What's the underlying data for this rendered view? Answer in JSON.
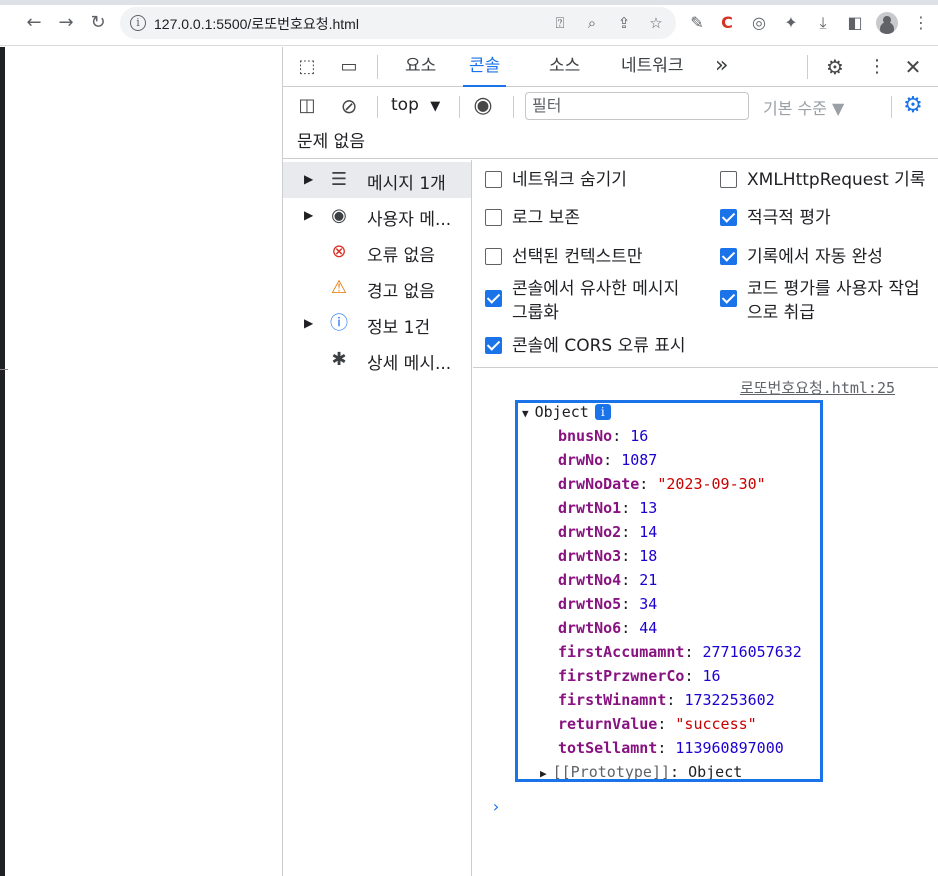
{
  "browser": {
    "url": "127.0.0.1:5500/로또번호요청.html",
    "nav": {
      "back_icon": "arrow-left-icon",
      "forward_icon": "arrow-right-icon",
      "reload_icon": "reload-icon"
    }
  },
  "devtools": {
    "tabs": [
      {
        "label": "요소",
        "active": false
      },
      {
        "label": "콘솔",
        "active": true
      },
      {
        "label": "소스",
        "active": false
      },
      {
        "label": "네트워크",
        "active": false
      }
    ],
    "more_tabs": "»",
    "context": "top",
    "filter_placeholder": "필터",
    "levels": "기본 수준 ▼",
    "issues": "문제 없음"
  },
  "sidebar": {
    "items": [
      {
        "label": "메시지 1개",
        "icon": "list-icon",
        "has_arrow": true
      },
      {
        "label": "사용자 메...",
        "icon": "user-icon",
        "has_arrow": true
      },
      {
        "label": "오류 없음",
        "icon": "error-icon",
        "has_arrow": false
      },
      {
        "label": "경고 없음",
        "icon": "warning-icon",
        "has_arrow": false
      },
      {
        "label": "정보 1건",
        "icon": "info-icon",
        "has_arrow": true
      },
      {
        "label": "상세 메시...",
        "icon": "bug-icon",
        "has_arrow": false
      }
    ]
  },
  "settings": {
    "left": [
      {
        "label": "네트워크 숨기기",
        "checked": false
      },
      {
        "label": "로그 보존",
        "checked": false
      },
      {
        "label": "선택된 컨텍스트만",
        "checked": false
      },
      {
        "label": "콘솔에서 유사한 메시지 그룹화",
        "checked": true
      },
      {
        "label": "콘솔에 CORS 오류 표시",
        "checked": true
      }
    ],
    "right": [
      {
        "label": "XMLHttpRequest 기록",
        "checked": false
      },
      {
        "label": "적극적 평가",
        "checked": true
      },
      {
        "label": "기록에서 자동 완성",
        "checked": true
      },
      {
        "label": "코드 평가를 사용자 작업으로 취급",
        "checked": true
      }
    ]
  },
  "console": {
    "source": "로또번호요청.html:25",
    "object_label": "Object",
    "info_badge": "i",
    "props": [
      {
        "key": "bnusNo",
        "value": "16",
        "kind": "num"
      },
      {
        "key": "drwNo",
        "value": "1087",
        "kind": "num"
      },
      {
        "key": "drwNoDate",
        "value": "\"2023-09-30\"",
        "kind": "str"
      },
      {
        "key": "drwtNo1",
        "value": "13",
        "kind": "num"
      },
      {
        "key": "drwtNo2",
        "value": "14",
        "kind": "num"
      },
      {
        "key": "drwtNo3",
        "value": "18",
        "kind": "num"
      },
      {
        "key": "drwtNo4",
        "value": "21",
        "kind": "num"
      },
      {
        "key": "drwtNo5",
        "value": "34",
        "kind": "num"
      },
      {
        "key": "drwtNo6",
        "value": "44",
        "kind": "num"
      },
      {
        "key": "firstAccumamnt",
        "value": "27716057632",
        "kind": "num"
      },
      {
        "key": "firstPrzwnerCo",
        "value": "16",
        "kind": "num"
      },
      {
        "key": "firstWinamnt",
        "value": "1732253602",
        "kind": "num"
      },
      {
        "key": "returnValue",
        "value": "\"success\"",
        "kind": "str"
      },
      {
        "key": "totSellamnt",
        "value": "113960897000",
        "kind": "num"
      }
    ],
    "prototype_key": "[[Prototype]]",
    "prototype_value": "Object",
    "prompt": "›"
  }
}
